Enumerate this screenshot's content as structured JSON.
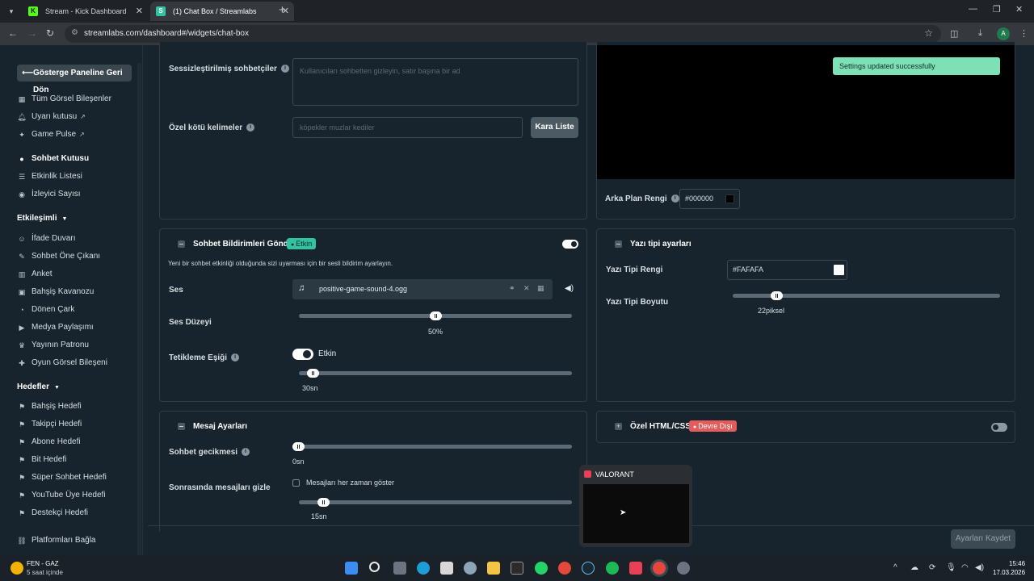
{
  "browser": {
    "tabs": [
      {
        "title": "Stream - Kick Dashboard",
        "favicon": "K"
      },
      {
        "title": "(1) Chat Box / Streamlabs",
        "favicon": "S"
      }
    ],
    "url": "streamlabs.com/dashboard#/widgets/chat-box",
    "profile_initial": "A"
  },
  "sidebar": {
    "back_label": "Gösterge Paneline Geri Dön",
    "items_top": [
      {
        "label": "Tüm Görsel Bileşenler",
        "icon": "grid-icon"
      },
      {
        "label": "Uyarı kutusu",
        "icon": "bell-icon",
        "external": true
      },
      {
        "label": "Game Pulse",
        "icon": "pulse-icon",
        "external": true
      }
    ],
    "items_main": [
      {
        "label": "Sohbet Kutusu",
        "icon": "chat-icon",
        "active": true
      },
      {
        "label": "Etkinlik Listesi",
        "icon": "list-icon"
      },
      {
        "label": "İzleyici Sayısı",
        "icon": "eye-icon"
      }
    ],
    "engagement_heading": "Etkileşimli",
    "engagement_items": [
      {
        "label": "İfade Duvarı",
        "icon": "emoji-icon"
      },
      {
        "label": "Sohbet Öne Çıkanı",
        "icon": "highlight-icon"
      },
      {
        "label": "Anket",
        "icon": "poll-icon"
      },
      {
        "label": "Bahşiş Kavanozu",
        "icon": "jar-icon"
      },
      {
        "label": "Dönen Çark",
        "icon": "wheel-icon"
      },
      {
        "label": "Medya Paylaşımı",
        "icon": "media-icon"
      },
      {
        "label": "Yayının Patronu",
        "icon": "crown-icon"
      },
      {
        "label": "Oyun Görsel Bileşeni",
        "icon": "game-icon"
      }
    ],
    "goals_heading": "Hedefler",
    "goal_items": [
      {
        "label": "Bahşiş Hedefi",
        "icon": "goal-icon"
      },
      {
        "label": "Takipçi Hedefi",
        "icon": "goal-icon"
      },
      {
        "label": "Abone Hedefi",
        "icon": "goal-icon"
      },
      {
        "label": "Bit Hedefi",
        "icon": "goal-icon"
      },
      {
        "label": "Süper Sohbet Hedefi",
        "icon": "goal-icon"
      },
      {
        "label": "YouTube Üye Hedefi",
        "icon": "goal-icon"
      },
      {
        "label": "Destekçi Hedefi",
        "icon": "goal-icon"
      }
    ],
    "connect_label": "Platformları Bağla"
  },
  "filters": {
    "muted_chatters_label": "Sessizleştirilmiş sohbetçiler",
    "muted_chatters_placeholder": "Kullanıcıları sohbetten gizleyin, satır başına bir ad",
    "bad_words_label": "Özel kötü kelimeler",
    "bad_words_placeholder": "köpekler muzlar kediler",
    "blacklist_button": "Kara Liste"
  },
  "preview": {
    "toast": "Settings updated successfully",
    "bg_color_label": "Arka Plan Rengi",
    "bg_color_value": "#000000"
  },
  "notifications": {
    "title": "Sohbet Bildirimleri Gönder",
    "badge": "Etkin",
    "enabled": true,
    "description": "Yeni bir sohbet etkinliği olduğunda sizi uyarması için bir sesli bildirim ayarlayın.",
    "sound_label": "Ses",
    "sound_file": "positive-game-sound-4.ogg",
    "volume_label": "Ses Düzeyi",
    "volume_value": "50%",
    "volume_fraction": 0.5,
    "threshold_label": "Tetikleme Eşiği",
    "threshold_toggle_label": "Etkin",
    "threshold_value": "30sn",
    "threshold_fraction": 0.03
  },
  "font": {
    "title": "Yazı tipi ayarları",
    "color_label": "Yazı Tipi Rengi",
    "color_value": "#FAFAFA",
    "size_label": "Yazı Tipi Boyutu",
    "size_value": "22piksel",
    "size_fraction": 0.15
  },
  "messages": {
    "title": "Mesaj Ayarları",
    "delay_label": "Sohbet gecikmesi",
    "delay_value": "0sn",
    "delay_fraction": 0.0,
    "hide_label": "Sonrasında mesajları gizle",
    "always_show_label": "Mesajları her zaman göster",
    "hide_value": "15sn",
    "hide_fraction": 0.07
  },
  "custom_html": {
    "title": "Özel HTML/CSS",
    "badge": "Devre Dışı",
    "enabled": false
  },
  "save_button": "Ayarları Kaydet",
  "thumbnail": {
    "title": "VALORANT"
  },
  "taskbar": {
    "weather_title": "FEN - GAZ",
    "weather_sub": "5 saat içinde",
    "time": "15:46",
    "date": "17.03.2026"
  },
  "colors": {
    "accent": "#31c3a2",
    "danger": "#e35b5b",
    "background": "#17242d"
  }
}
